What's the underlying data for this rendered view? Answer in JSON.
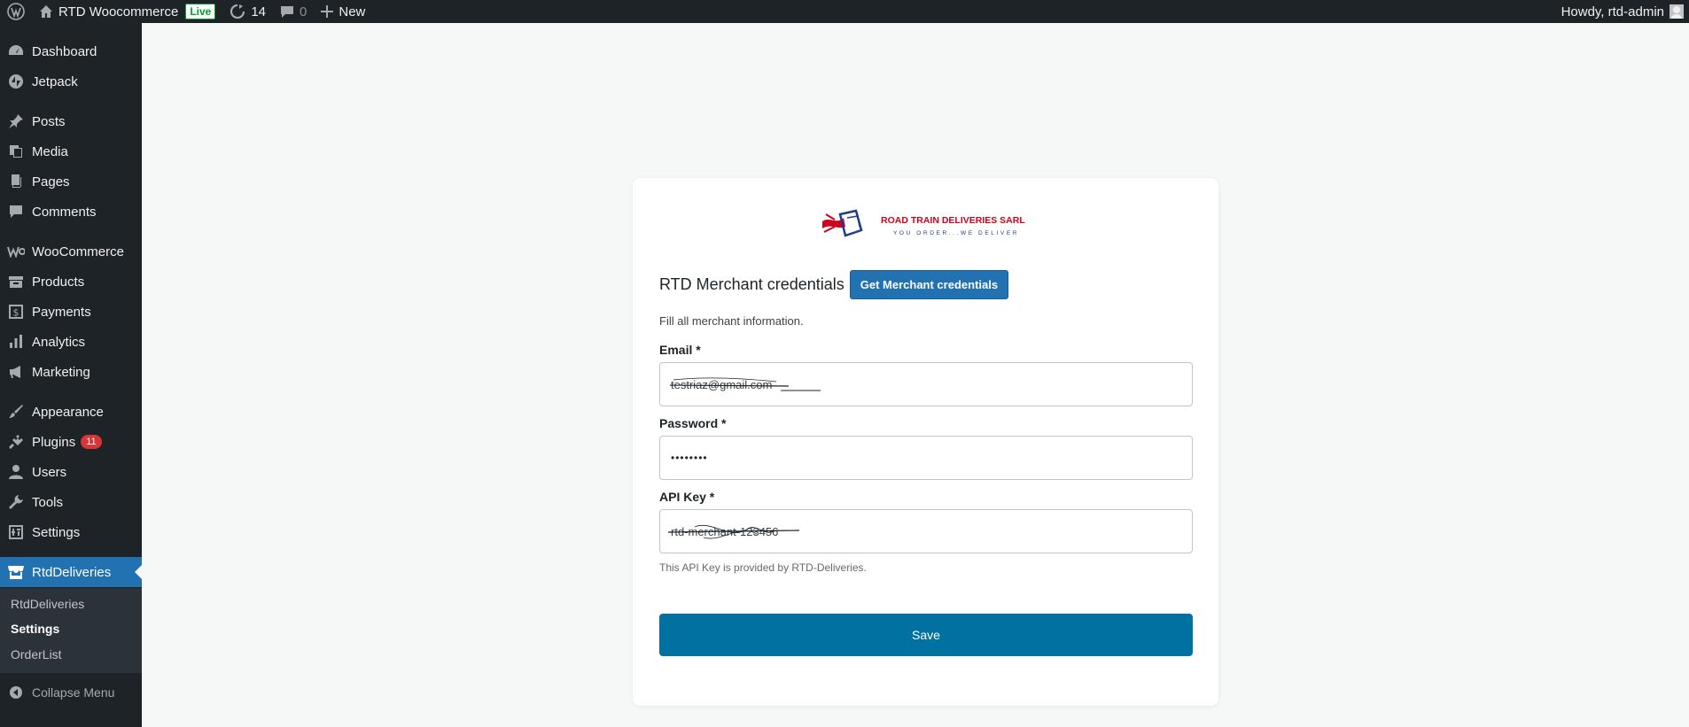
{
  "adminbar": {
    "site_name": "RTD Woocommerce",
    "live_label": "Live",
    "updates_count": "14",
    "comments_count": "0",
    "new_label": "New",
    "howdy": "Howdy, rtd-admin"
  },
  "sidebar": {
    "items": [
      {
        "label": "Dashboard",
        "icon": "dashboard-icon"
      },
      {
        "label": "Jetpack",
        "icon": "jetpack-icon"
      },
      {
        "label": "Posts",
        "icon": "pin-icon"
      },
      {
        "label": "Media",
        "icon": "media-icon"
      },
      {
        "label": "Pages",
        "icon": "pages-icon"
      },
      {
        "label": "Comments",
        "icon": "comment-icon"
      },
      {
        "label": "WooCommerce",
        "icon": "woo-icon"
      },
      {
        "label": "Products",
        "icon": "archive-icon"
      },
      {
        "label": "Payments",
        "icon": "dollar-icon"
      },
      {
        "label": "Analytics",
        "icon": "bar-chart-icon"
      },
      {
        "label": "Marketing",
        "icon": "megaphone-icon"
      },
      {
        "label": "Appearance",
        "icon": "brush-icon"
      },
      {
        "label": "Plugins",
        "icon": "plugin-icon",
        "badge": "11"
      },
      {
        "label": "Users",
        "icon": "user-icon"
      },
      {
        "label": "Tools",
        "icon": "wrench-icon"
      },
      {
        "label": "Settings",
        "icon": "settings-icon"
      },
      {
        "label": "RtdDeliveries",
        "icon": "store-icon"
      }
    ],
    "submenu": [
      "RtdDeliveries",
      "Settings",
      "OrderList"
    ],
    "collapse_label": "Collapse Menu"
  },
  "form": {
    "logo_title": "ROAD TRAIN DELIVERIES SARL",
    "logo_tagline": "YOU ORDER...WE DELIVER",
    "heading": "RTD Merchant credentials",
    "get_credentials_label": "Get Merchant credentials",
    "description": "Fill all merchant information.",
    "email_label": "Email *",
    "email_value": "testriaz@gmail.com",
    "password_label": "Password *",
    "password_value": "••••••••",
    "apikey_label": "API Key *",
    "apikey_value": "rtd-merchant-123456",
    "apikey_help": "This API Key is provided by RTD-Deliveries.",
    "save_label": "Save"
  },
  "colors": {
    "admin_dark": "#1d2327",
    "wp_blue": "#2271b1",
    "save_blue": "#0071a1",
    "badge_red": "#d63638",
    "logo_red": "#d0021b",
    "logo_navy": "#1f3c88"
  }
}
